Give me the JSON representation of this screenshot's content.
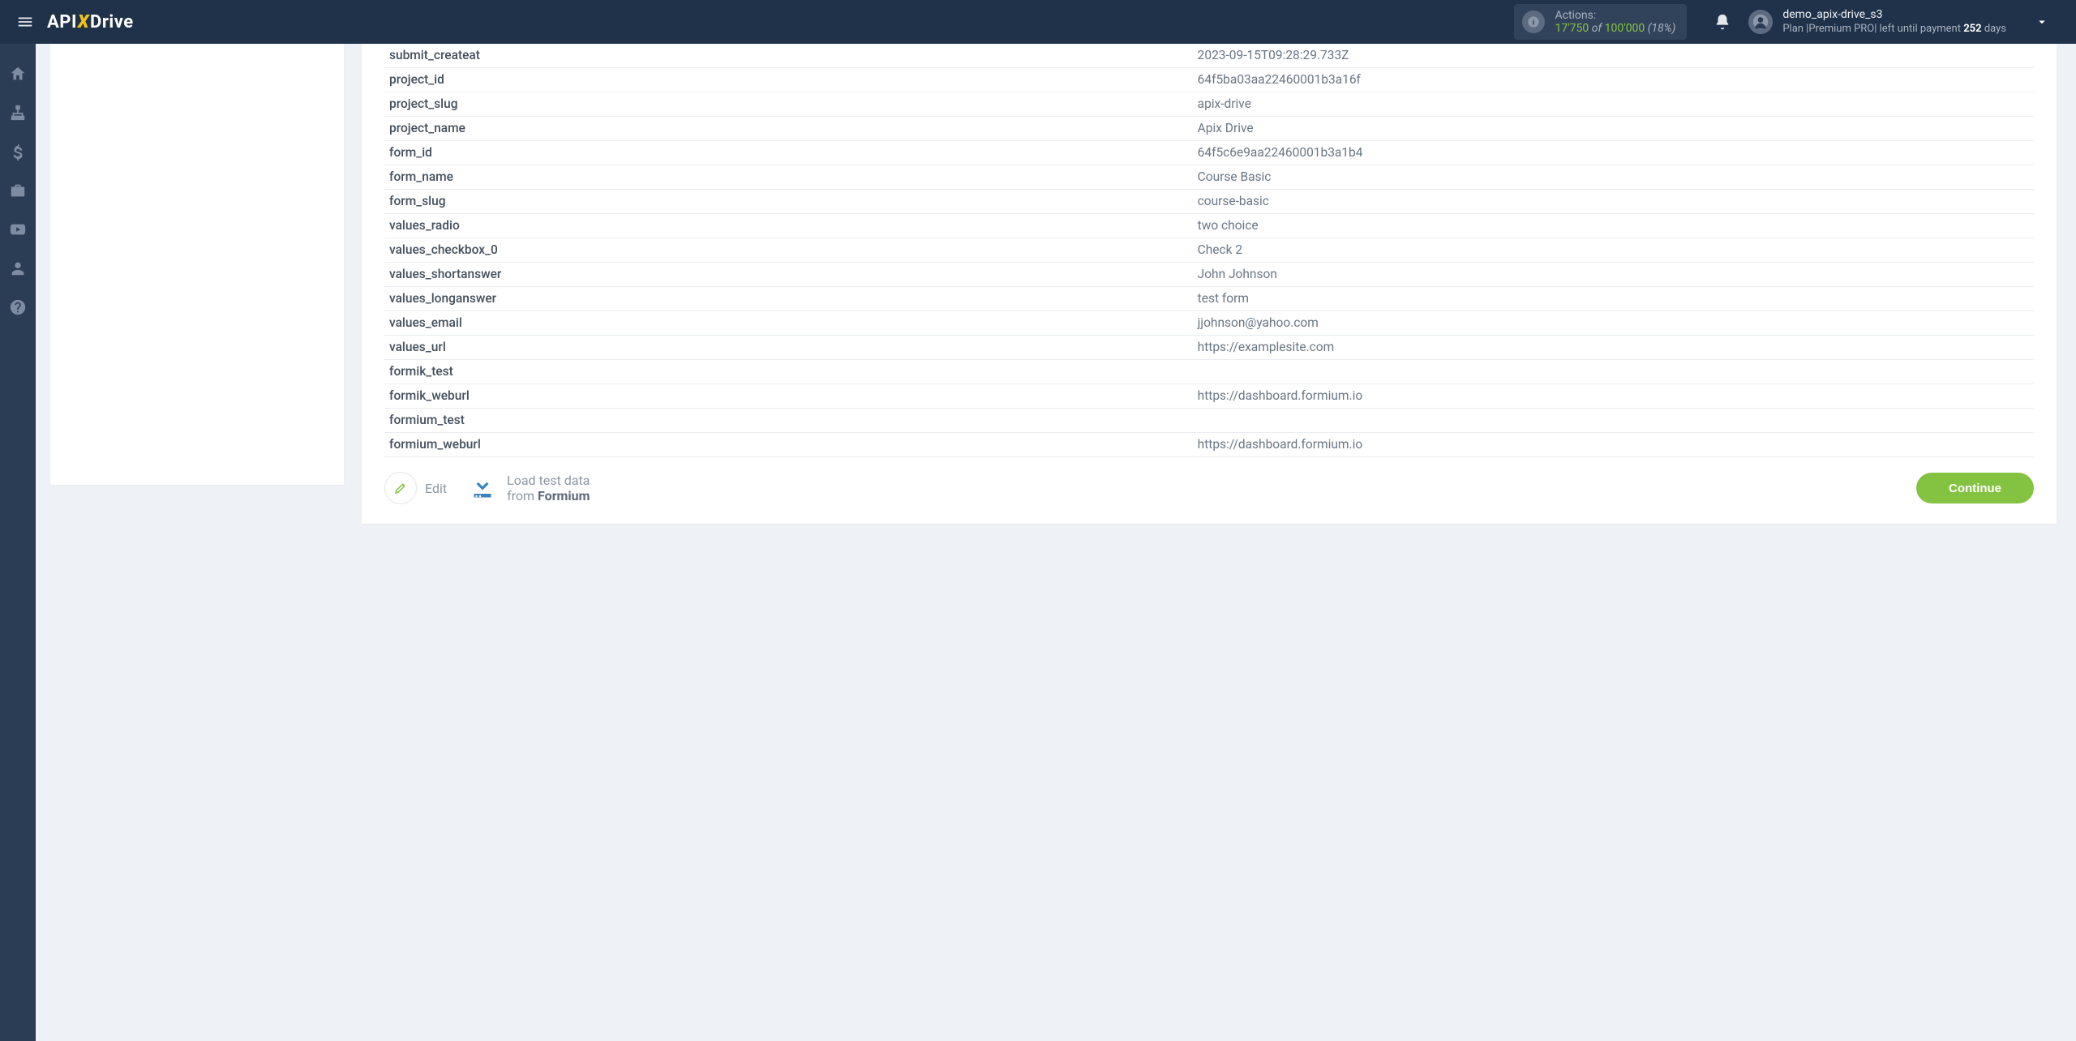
{
  "header": {
    "logo_api": "API",
    "logo_x": "X",
    "logo_drive": "Drive",
    "actions_label": "Actions:",
    "actions_current": "17'750",
    "actions_of": " of ",
    "actions_total": "100'000",
    "actions_pct": " (18%)",
    "user_name": "demo_apix-drive_s3",
    "user_plan_prefix": "Plan |Premium PRO| left until payment ",
    "user_days": "252",
    "user_days_suffix": " days"
  },
  "rows": [
    {
      "key": "submit_createat",
      "val": "2023-09-15T09:28:29.733Z"
    },
    {
      "key": "project_id",
      "val": "64f5ba03aa22460001b3a16f"
    },
    {
      "key": "project_slug",
      "val": "apix-drive"
    },
    {
      "key": "project_name",
      "val": "Apix Drive"
    },
    {
      "key": "form_id",
      "val": "64f5c6e9aa22460001b3a1b4"
    },
    {
      "key": "form_name",
      "val": "Course Basic"
    },
    {
      "key": "form_slug",
      "val": "course-basic"
    },
    {
      "key": "values_radio",
      "val": "two choice"
    },
    {
      "key": "values_checkbox_0",
      "val": "Check 2"
    },
    {
      "key": "values_shortanswer",
      "val": "John Johnson"
    },
    {
      "key": "values_longanswer",
      "val": "test form"
    },
    {
      "key": "values_email",
      "val": "jjohnson@yahoo.com"
    },
    {
      "key": "values_url",
      "val": "https://examplesite.com"
    },
    {
      "key": "formik_test",
      "val": ""
    },
    {
      "key": "formik_weburl",
      "val": "https://dashboard.formium.io"
    },
    {
      "key": "formium_test",
      "val": ""
    },
    {
      "key": "formium_weburl",
      "val": "https://dashboard.formium.io"
    }
  ],
  "buttons": {
    "edit": "Edit",
    "load_line1": "Load test data",
    "load_line2_prefix": "from ",
    "load_line2_brand": "Formium",
    "continue": "Continue"
  }
}
